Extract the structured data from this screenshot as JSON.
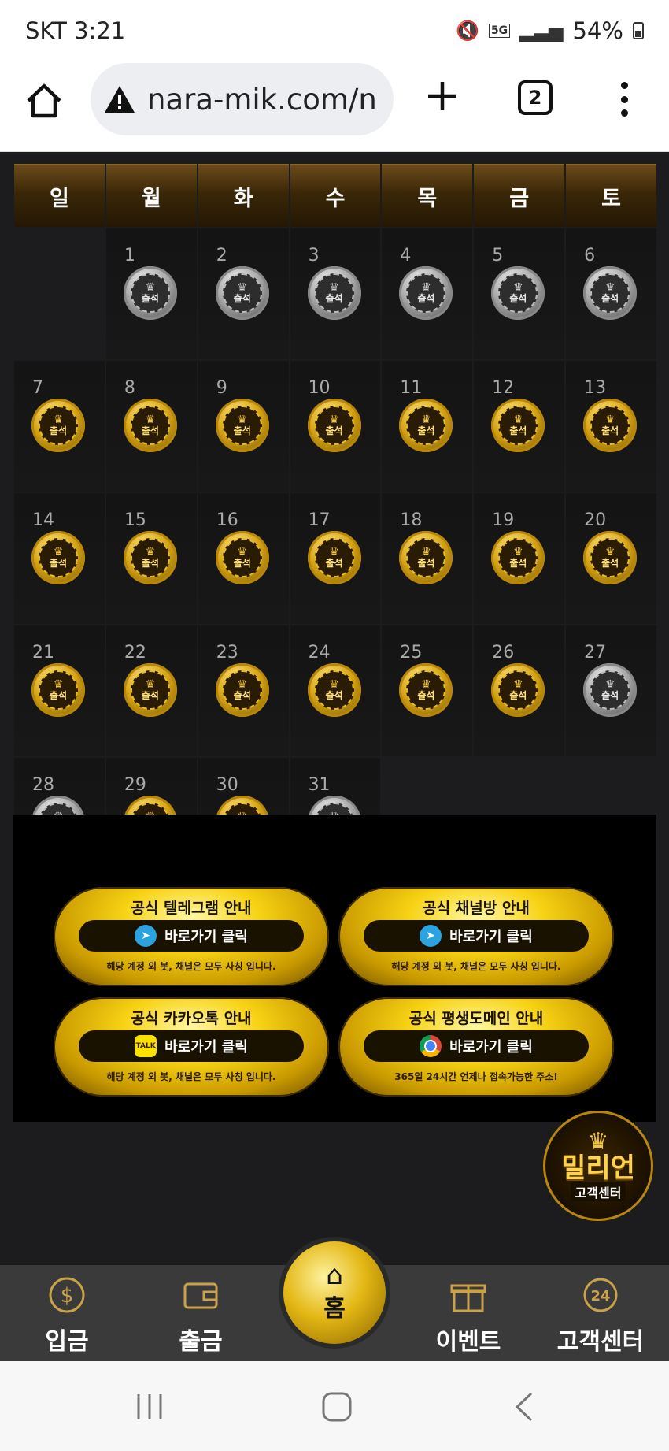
{
  "status": {
    "carrier_time": "SKT 3:21",
    "network": "5G",
    "battery": "54%"
  },
  "browser": {
    "url": "nara-mik.com/n",
    "tab_count": "2"
  },
  "calendar": {
    "weekdays": [
      "일",
      "월",
      "화",
      "수",
      "목",
      "금",
      "토"
    ],
    "badge_label": "출석",
    "days": [
      {
        "n": "",
        "s": "blank"
      },
      {
        "n": "1",
        "s": "silver"
      },
      {
        "n": "2",
        "s": "silver"
      },
      {
        "n": "3",
        "s": "silver"
      },
      {
        "n": "4",
        "s": "silver"
      },
      {
        "n": "5",
        "s": "silver"
      },
      {
        "n": "6",
        "s": "silver"
      },
      {
        "n": "7",
        "s": "gold"
      },
      {
        "n": "8",
        "s": "gold"
      },
      {
        "n": "9",
        "s": "gold"
      },
      {
        "n": "10",
        "s": "gold"
      },
      {
        "n": "11",
        "s": "gold"
      },
      {
        "n": "12",
        "s": "gold"
      },
      {
        "n": "13",
        "s": "gold"
      },
      {
        "n": "14",
        "s": "gold"
      },
      {
        "n": "15",
        "s": "gold"
      },
      {
        "n": "16",
        "s": "gold"
      },
      {
        "n": "17",
        "s": "gold"
      },
      {
        "n": "18",
        "s": "gold"
      },
      {
        "n": "19",
        "s": "gold"
      },
      {
        "n": "20",
        "s": "gold"
      },
      {
        "n": "21",
        "s": "gold"
      },
      {
        "n": "22",
        "s": "gold"
      },
      {
        "n": "23",
        "s": "gold"
      },
      {
        "n": "24",
        "s": "gold"
      },
      {
        "n": "25",
        "s": "gold"
      },
      {
        "n": "26",
        "s": "gold"
      },
      {
        "n": "27",
        "s": "silver"
      },
      {
        "n": "28",
        "s": "silver"
      },
      {
        "n": "29",
        "s": "gold"
      },
      {
        "n": "30",
        "s": "gold"
      },
      {
        "n": "31",
        "s": "silver"
      }
    ]
  },
  "promo": {
    "telegram": {
      "title": "공식 텔레그램 안내",
      "button": "바로가기 클릭",
      "note": "해당 계정 외 봇, 채널은 모두 사칭 입니다."
    },
    "channel": {
      "title": "공식 채널방 안내",
      "button": "바로가기 클릭",
      "note": "해당 계정 외 봇, 채널은 모두 사칭 입니다."
    },
    "kakao": {
      "title": "공식 카카오톡 안내",
      "button": "바로가기 클릭",
      "note": "해당 계정 외 봇, 채널은 모두 사칭 입니다.",
      "icon_text": "TALK"
    },
    "domain": {
      "title": "공식 평생도메인 안내",
      "button": "바로가기 클릭",
      "note": "365일 24시간 언제나 접속가능한 주소!"
    }
  },
  "million": {
    "name": "밀리언",
    "sub": "고객센터"
  },
  "nav": {
    "deposit": "입금",
    "withdraw": "출금",
    "home": "홈",
    "event": "이벤트",
    "support": "고객센터",
    "support_icon_text": "24"
  }
}
